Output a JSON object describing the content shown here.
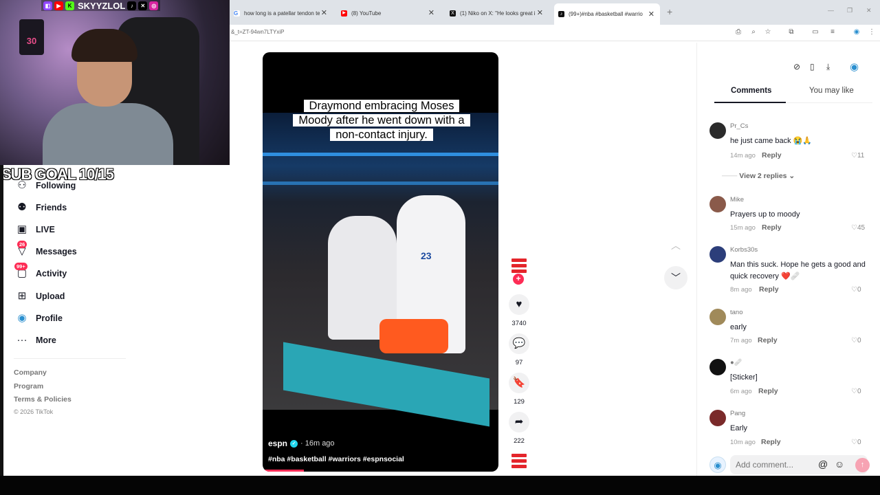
{
  "browser": {
    "tabs": [
      {
        "label": "how long is a patellar tendon te",
        "color": "#4285f4",
        "fav": "G"
      },
      {
        "label": "(8) YouTube",
        "color": "#ff0000",
        "fav": "▶"
      },
      {
        "label": "(1) Niko on X: \"He looks great i",
        "color": "#111111",
        "fav": "X"
      },
      {
        "label": "(99+)#nba #basketball #warrio",
        "color": "#111111",
        "fav": "♪"
      }
    ],
    "url": "&_t=ZT-94wn7LTYxiP"
  },
  "stream": {
    "handle": "SKYYZLOL",
    "jersey_number": "30",
    "sub_goal": "SUB GOAL 10/15"
  },
  "sidebar": {
    "items": [
      {
        "label": "Following",
        "icon": "following-icon"
      },
      {
        "label": "Friends",
        "icon": "friends-icon"
      },
      {
        "label": "LIVE",
        "icon": "live-icon"
      },
      {
        "label": "Messages",
        "icon": "messages-icon",
        "badge": "26"
      },
      {
        "label": "Activity",
        "icon": "activity-icon",
        "badge": "99+"
      },
      {
        "label": "Upload",
        "icon": "upload-icon"
      },
      {
        "label": "Profile",
        "icon": "profile-icon"
      },
      {
        "label": "More",
        "icon": "more-icon"
      }
    ],
    "footer": [
      "Company",
      "Program",
      "Terms & Policies"
    ],
    "copyright": "© 2026 TikTok"
  },
  "video": {
    "caption": "Draymond embracing Moses Moody after he went down with a non-contact injury.",
    "caption_lines": [
      "Draymond embracing Moses",
      "Moody after he went down with a",
      "non-contact injury."
    ],
    "jersey_number": "23",
    "author": "espn",
    "time": "· 16m ago",
    "hashtags": "#nba #basketball #warriors #espnsocial",
    "likes": "3740",
    "comments": "97",
    "saves": "129",
    "shares": "222"
  },
  "panel": {
    "tab_comments": "Comments",
    "tab_you_may_like": "You may like",
    "view_replies": "View 2 replies",
    "reply_label": "Reply",
    "comments": [
      {
        "user": "Pr_Cs",
        "text": "he just came back 😭🙏",
        "time": "14m ago",
        "likes": "11",
        "avatar": "#2b2b2b"
      },
      {
        "user": "Mike",
        "text": "Prayers up to moody",
        "time": "15m ago",
        "likes": "45",
        "avatar": "#8a5a4a"
      },
      {
        "user": "Korbs30s",
        "text": "Man this suck. Hope he gets a good and quick recovery ❤️🩹",
        "time": "8m ago",
        "likes": "0",
        "avatar": "#2c3e7a"
      },
      {
        "user": "tano",
        "text": "early",
        "time": "7m ago",
        "likes": "0",
        "avatar": "#a08a5a"
      },
      {
        "user": "●🩹",
        "text": "[Sticker]",
        "time": "6m ago",
        "likes": "0",
        "avatar": "#111111"
      },
      {
        "user": "Pang",
        "text": "Early",
        "time": "10m ago",
        "likes": "0",
        "avatar": "#7a2a2a"
      }
    ],
    "add_comment_placeholder": "Add comment..."
  }
}
